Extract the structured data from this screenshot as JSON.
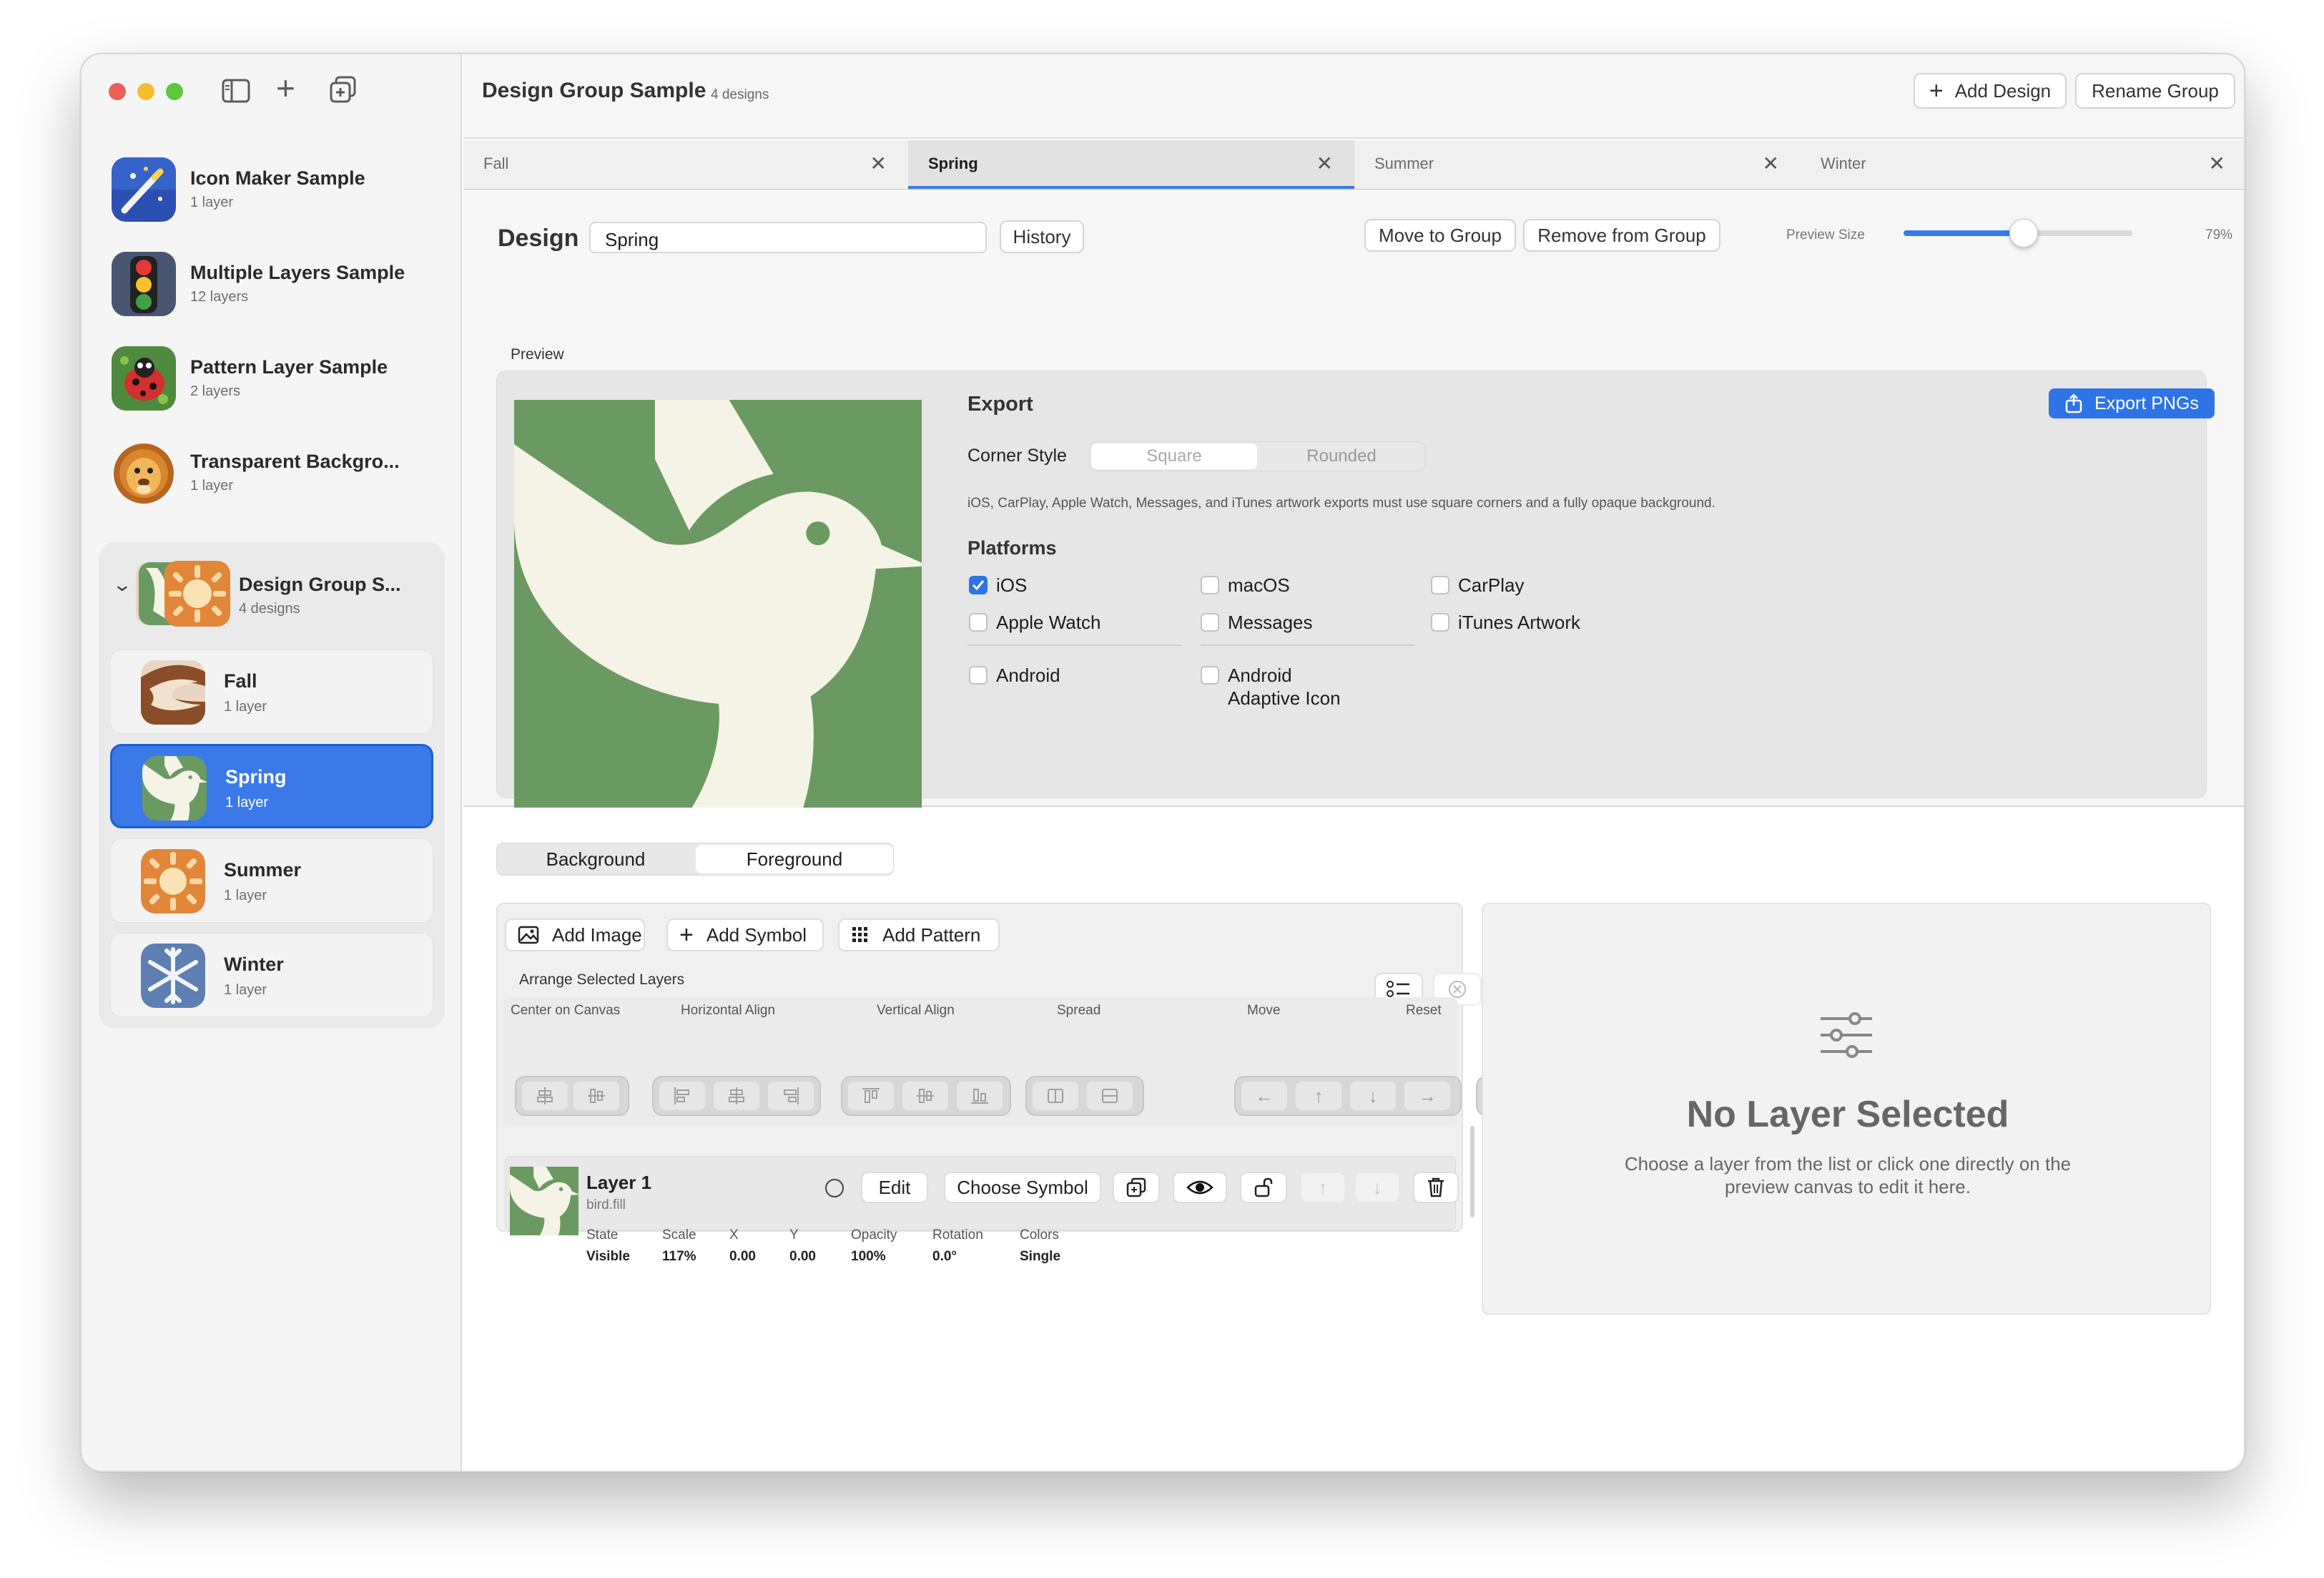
{
  "toolbar": {
    "add_icon": "+",
    "duplicate_icon": "⧉"
  },
  "sidebar": {
    "items": [
      {
        "title": "Icon Maker Sample",
        "subtitle": "1 layer",
        "icon": "magic-wand-icon"
      },
      {
        "title": "Multiple Layers Sample",
        "subtitle": "12 layers",
        "icon": "traffic-light-icon"
      },
      {
        "title": "Pattern Layer Sample",
        "subtitle": "2 layers",
        "icon": "ladybug-icon"
      },
      {
        "title": "Transparent Backgro...",
        "subtitle": "1 layer",
        "icon": "lion-icon"
      }
    ],
    "group": {
      "title": "Design Group S...",
      "subtitle": "4 designs",
      "chevron": "⌄",
      "children": [
        {
          "title": "Fall",
          "subtitle": "1 layer"
        },
        {
          "title": "Spring",
          "subtitle": "1 layer"
        },
        {
          "title": "Summer",
          "subtitle": "1 layer"
        },
        {
          "title": "Winter",
          "subtitle": "1 layer"
        }
      ]
    }
  },
  "header": {
    "title": "Design Group Sample",
    "subtitle": "4 designs",
    "add_design": "Add Design",
    "add_icon": "+",
    "rename_group": "Rename Group"
  },
  "tabs": [
    {
      "label": "Fall"
    },
    {
      "label": "Spring"
    },
    {
      "label": "Summer"
    },
    {
      "label": "Winter"
    }
  ],
  "tab_close": "✕",
  "design": {
    "label": "Design",
    "name_value": "Spring",
    "history": "History",
    "move_to_group": "Move to Group",
    "remove_from_group": "Remove from Group",
    "preview_size_label": "Preview Size",
    "preview_size_value": "79%",
    "preview_size_fraction": 0.52,
    "preview_label": "Preview"
  },
  "export": {
    "title": "Export",
    "button": "Export PNGs",
    "corner_style_label": "Corner Style",
    "corner_options": [
      "Square",
      "Rounded"
    ],
    "note": "iOS, CarPlay, Apple Watch, Messages, and iTunes artwork exports must use square corners and a fully opaque background.",
    "platforms_title": "Platforms",
    "platforms": [
      {
        "label": "iOS",
        "checked": true
      },
      {
        "label": "macOS",
        "checked": false
      },
      {
        "label": "CarPlay",
        "checked": false
      },
      {
        "label": "Apple Watch",
        "checked": false
      },
      {
        "label": "Messages",
        "checked": false
      },
      {
        "label": "iTunes Artwork",
        "checked": false
      },
      {
        "label": "Android",
        "checked": false
      },
      {
        "label": "Android",
        "label2": "Adaptive Icon",
        "checked": false
      }
    ]
  },
  "layers": {
    "segments": [
      "Background",
      "Foreground"
    ],
    "add_image": "Add Image",
    "add_symbol": "Add Symbol",
    "add_pattern": "Add Pattern",
    "arrange_title": "Arrange Selected Layers",
    "arrange_groups": [
      "Center on Canvas",
      "Horizontal Align",
      "Vertical Align",
      "Spread",
      "Move",
      "Reset"
    ],
    "arrows": {
      "left": "←",
      "up": "↑",
      "down": "↓",
      "right": "→",
      "reset": "↺"
    },
    "layer": {
      "name": "Layer 1",
      "symbol": "bird.fill",
      "edit": "Edit",
      "choose_symbol": "Choose Symbol",
      "up": "↑",
      "down": "↓",
      "fields": [
        {
          "label": "State",
          "value": "Visible"
        },
        {
          "label": "Scale",
          "value": "117%"
        },
        {
          "label": "X",
          "value": "0.00"
        },
        {
          "label": "Y",
          "value": "0.00"
        },
        {
          "label": "Opacity",
          "value": "100%"
        },
        {
          "label": "Rotation",
          "value": "0.0°"
        },
        {
          "label": "Colors",
          "value": "Single"
        }
      ]
    }
  },
  "empty_state": {
    "title": "No Layer Selected",
    "line1": "Choose a layer from the list or click one directly on the",
    "line2": "preview canvas to edit it here."
  },
  "colors": {
    "accent": "#3a7ae8",
    "spring_green": "#6a9a62",
    "bird_cream": "#f5f3e6"
  }
}
